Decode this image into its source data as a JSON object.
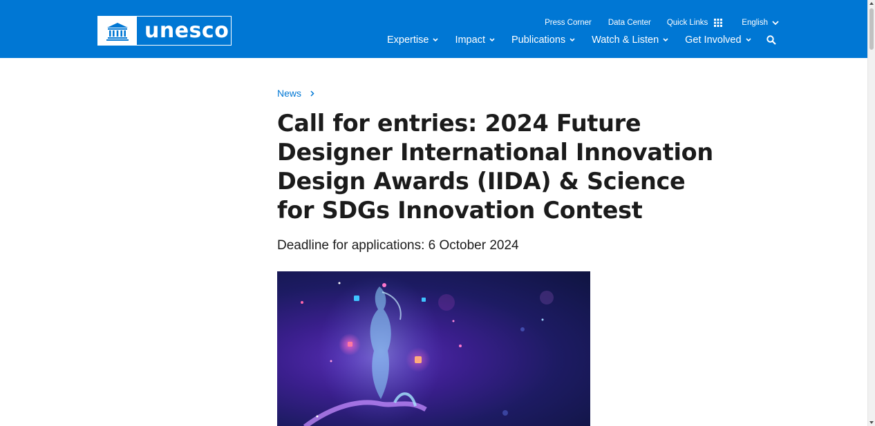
{
  "header": {
    "logo_text": "unesco",
    "util_nav": {
      "press_corner": "Press Corner",
      "data_center": "Data Center",
      "quick_links": "Quick Links",
      "language": "English"
    },
    "main_nav": [
      {
        "label": "Expertise"
      },
      {
        "label": "Impact"
      },
      {
        "label": "Publications"
      },
      {
        "label": "Watch & Listen"
      },
      {
        "label": "Get Involved"
      }
    ]
  },
  "article": {
    "breadcrumb": "News",
    "title": "Call for entries: 2024 Future Designer International Innovation Design Awards (IIDA) & Science for SDGs Innovation Contest",
    "subtitle": "Deadline for applications: 6 October 2024"
  },
  "colors": {
    "brand_blue": "#0077d4",
    "text": "#1b1b1b",
    "background": "#ffffff"
  },
  "icons": [
    "unesco-temple-icon",
    "grid-icon",
    "chevron-down-icon",
    "search-icon",
    "chevron-right-icon"
  ]
}
